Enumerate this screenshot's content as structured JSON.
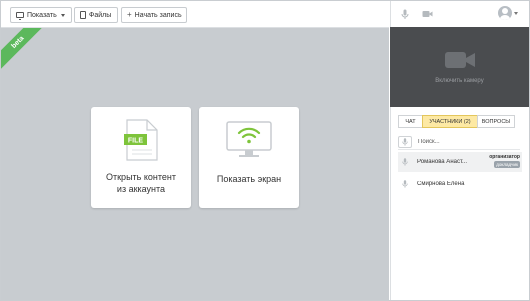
{
  "toolbar": {
    "show_label": "Показать",
    "files_label": "Файлы",
    "record_label": "Начать запись"
  },
  "stage": {
    "beta_label": "beta",
    "cards": [
      {
        "icon": "file-icon",
        "icon_text": "FILE",
        "label_line1": "Открыть контент",
        "label_line2": "из аккаунта"
      },
      {
        "icon": "screen-share-icon",
        "label_line1": "Показать экран"
      }
    ]
  },
  "video": {
    "enable_camera_label": "Включить камеру"
  },
  "tabs": [
    {
      "label": "ЧАТ",
      "active": false
    },
    {
      "label": "УЧАСТНИКИ (2)",
      "active": true
    },
    {
      "label": "ВОПРОСЫ",
      "active": false
    }
  ],
  "search": {
    "placeholder": "Поиск..."
  },
  "participants": [
    {
      "name": "Романова Анаст...",
      "role": "организатор",
      "badge": "докладчик"
    },
    {
      "name": "Смирнова Елена"
    }
  ],
  "colors": {
    "beta_ribbon": "#5cb85c",
    "active_tab": "#fde9a4",
    "stage_bg": "#c8ccd0",
    "video_bg": "#4a4c4f"
  }
}
